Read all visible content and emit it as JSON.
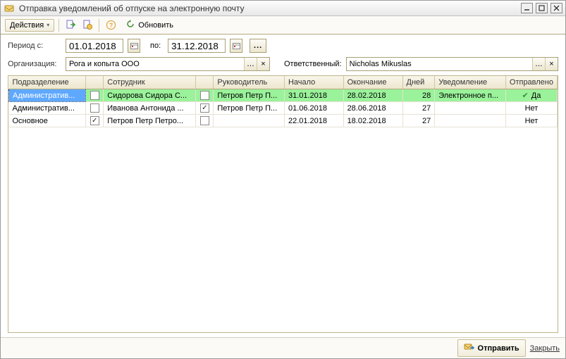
{
  "window": {
    "title": "Отправка уведомлений об отпуске на электронную почту"
  },
  "toolbar": {
    "actions_label": "Действия",
    "refresh_label": "Обновить"
  },
  "filters": {
    "period_label": "Период с:",
    "period_to_label": "по:",
    "period_from": "01.01.2018",
    "period_to": "31.12.2018",
    "org_label": "Организация:",
    "org_value": "Рога и копыта ООО",
    "responsible_label": "Ответственный:",
    "responsible_value": "Nicholas Mikuslas"
  },
  "grid": {
    "headers": {
      "dept": "Подразделение",
      "chk1": "",
      "employee": "Сотрудник",
      "chk2": "",
      "manager": "Руководитель",
      "start": "Начало",
      "end": "Окончание",
      "days": "Дней",
      "notif": "Уведомление",
      "sent": "Отправлено"
    },
    "rows": [
      {
        "dept": "Административ...",
        "chk1": false,
        "emp": "Сидорова Сидора С...",
        "chk2": false,
        "mgr": "Петров Петр П...",
        "start": "31.01.2018",
        "end": "28.02.2018",
        "days": "28",
        "notif": "Электронное п...",
        "sent": "Да",
        "sent_ok": true,
        "selected": true
      },
      {
        "dept": "Административ...",
        "chk1": false,
        "emp": "Иванова Антонида ...",
        "chk2": true,
        "mgr": "Петров Петр П...",
        "start": "01.06.2018",
        "end": "28.06.2018",
        "days": "27",
        "notif": "",
        "sent": "Нет",
        "sent_ok": false,
        "selected": false
      },
      {
        "dept": "Основное",
        "chk1": true,
        "emp": "Петров Петр Петро...",
        "chk2": false,
        "mgr": "",
        "start": "22.01.2018",
        "end": "18.02.2018",
        "days": "27",
        "notif": "",
        "sent": "Нет",
        "sent_ok": false,
        "selected": false
      }
    ]
  },
  "footer": {
    "send_label": "Отправить",
    "close_label": "Закрыть"
  }
}
